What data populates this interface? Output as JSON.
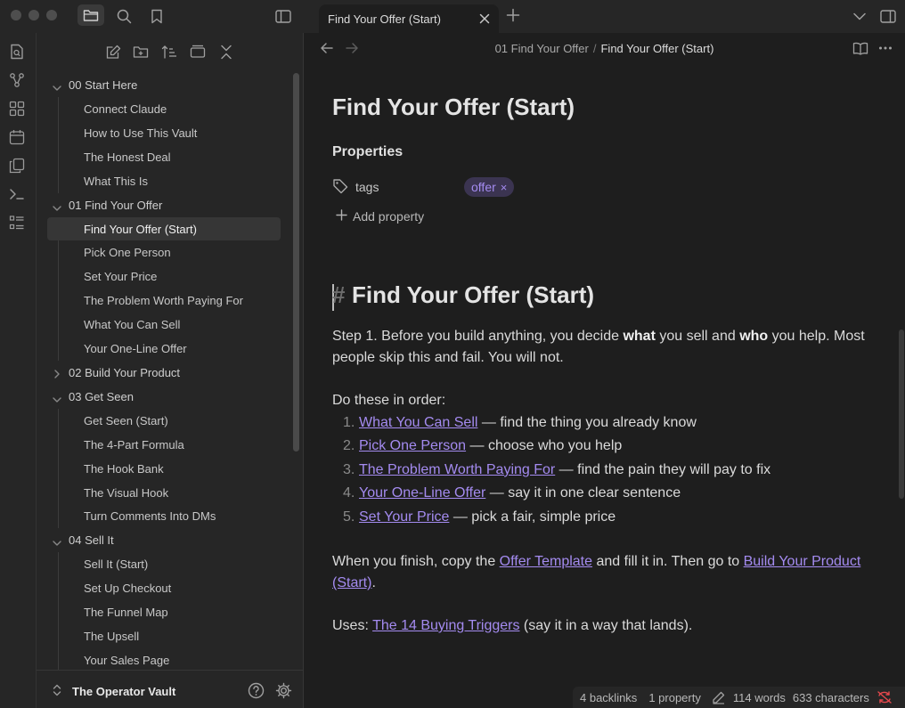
{
  "tab": {
    "title": "Find Your Offer (Start)"
  },
  "breadcrumb": {
    "folder": "01 Find Your Offer",
    "separator": "/",
    "current": "Find Your Offer (Start)"
  },
  "sidebar": {
    "vault_name": "The Operator Vault",
    "tree": [
      {
        "type": "folder",
        "name": "00 Start Here",
        "expanded": true
      },
      {
        "type": "file",
        "name": "Connect Claude"
      },
      {
        "type": "file",
        "name": "How to Use This Vault"
      },
      {
        "type": "file",
        "name": "The Honest Deal"
      },
      {
        "type": "file",
        "name": "What This Is"
      },
      {
        "type": "folder",
        "name": "01 Find Your Offer",
        "expanded": true
      },
      {
        "type": "file",
        "name": "Find Your Offer (Start)",
        "active": true
      },
      {
        "type": "file",
        "name": "Pick One Person"
      },
      {
        "type": "file",
        "name": "Set Your Price"
      },
      {
        "type": "file",
        "name": "The Problem Worth Paying For"
      },
      {
        "type": "file",
        "name": "What You Can Sell"
      },
      {
        "type": "file",
        "name": "Your One-Line Offer"
      },
      {
        "type": "folder",
        "name": "02 Build Your Product",
        "expanded": false
      },
      {
        "type": "folder",
        "name": "03 Get Seen",
        "expanded": true
      },
      {
        "type": "file",
        "name": "Get Seen (Start)"
      },
      {
        "type": "file",
        "name": "The 4-Part Formula"
      },
      {
        "type": "file",
        "name": "The Hook Bank"
      },
      {
        "type": "file",
        "name": "The Visual Hook"
      },
      {
        "type": "file",
        "name": "Turn Comments Into DMs"
      },
      {
        "type": "folder",
        "name": "04 Sell It",
        "expanded": true
      },
      {
        "type": "file",
        "name": "Sell It (Start)"
      },
      {
        "type": "file",
        "name": "Set Up Checkout"
      },
      {
        "type": "file",
        "name": "The Funnel Map"
      },
      {
        "type": "file",
        "name": "The Upsell"
      },
      {
        "type": "file",
        "name": "Your Sales Page"
      }
    ]
  },
  "note": {
    "inline_title": "Find Your Offer (Start)",
    "properties_heading": "Properties",
    "property_key": "tags",
    "tag_value": "offer",
    "tag_remove": "×",
    "add_property": "Add property",
    "heading_hash": "#",
    "heading": "Find Your Offer (Start)",
    "intro_a": "Step 1. Before you build anything, you decide ",
    "intro_b": "what",
    "intro_c": " you sell and ",
    "intro_d": "who",
    "intro_e": " you help. Most people skip this and fail. You will not.",
    "order_lead": "Do these in order:",
    "steps": [
      {
        "num": "1.",
        "link": "What You Can Sell",
        "text": " — find the thing you already know"
      },
      {
        "num": "2.",
        "link": "Pick One Person",
        "text": " — choose who you help"
      },
      {
        "num": "3.",
        "link": "The Problem Worth Paying For",
        "text": " — find the pain they will pay to fix"
      },
      {
        "num": "4.",
        "link": "Your One-Line Offer",
        "text": " — say it in one clear sentence"
      },
      {
        "num": "5.",
        "link": "Set Your Price",
        "text": " — pick a fair, simple price"
      }
    ],
    "finish_a": "When you finish, copy the ",
    "finish_link1": "Offer Template",
    "finish_b": " and fill it in. Then go to ",
    "finish_link2": "Build Your Product (Start)",
    "finish_c": ".",
    "uses_a": "Uses: ",
    "uses_link": "The 14 Buying Triggers",
    "uses_b": " (say it in a way that lands)."
  },
  "status": {
    "backlinks": "4 backlinks",
    "properties": "1 property",
    "words": "114 words",
    "characters": "633 characters"
  },
  "colors": {
    "accent": "#a48bf0",
    "background": "#1e1e1e",
    "panel": "#262626",
    "sync_error": "#e5484d"
  }
}
